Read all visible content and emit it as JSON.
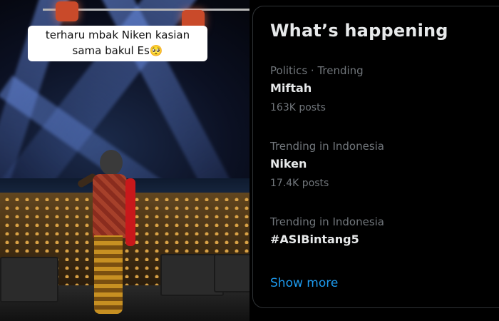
{
  "video": {
    "caption": "terharu mbak Niken kasian sama bakul Es🥺"
  },
  "panel": {
    "title": "What’s happening",
    "trends": [
      {
        "meta": "Politics · Trending",
        "name": "Miftah",
        "count": "163K posts"
      },
      {
        "meta": "Trending in Indonesia",
        "name": "Niken",
        "count": "17.4K posts"
      },
      {
        "meta": "Trending in Indonesia",
        "name": "#ASIBintang5"
      }
    ],
    "show_more": "Show more"
  },
  "colors": {
    "accent": "#1d9bf0",
    "text_primary": "#e7e9ea",
    "text_secondary": "#71767b",
    "border": "#2f3336"
  }
}
